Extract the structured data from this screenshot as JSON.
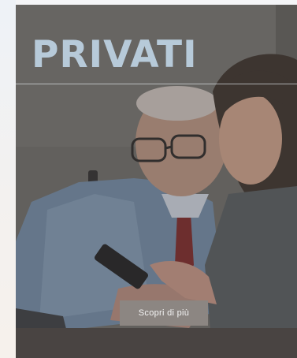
{
  "banner": {
    "title": "PRIVATI",
    "cta_label": "Scopri di più",
    "photo_alt": "Anziano e giovane donna che guardano uno smartphone",
    "colors": {
      "title": "#b7cad9",
      "button": "#8c8682"
    }
  }
}
